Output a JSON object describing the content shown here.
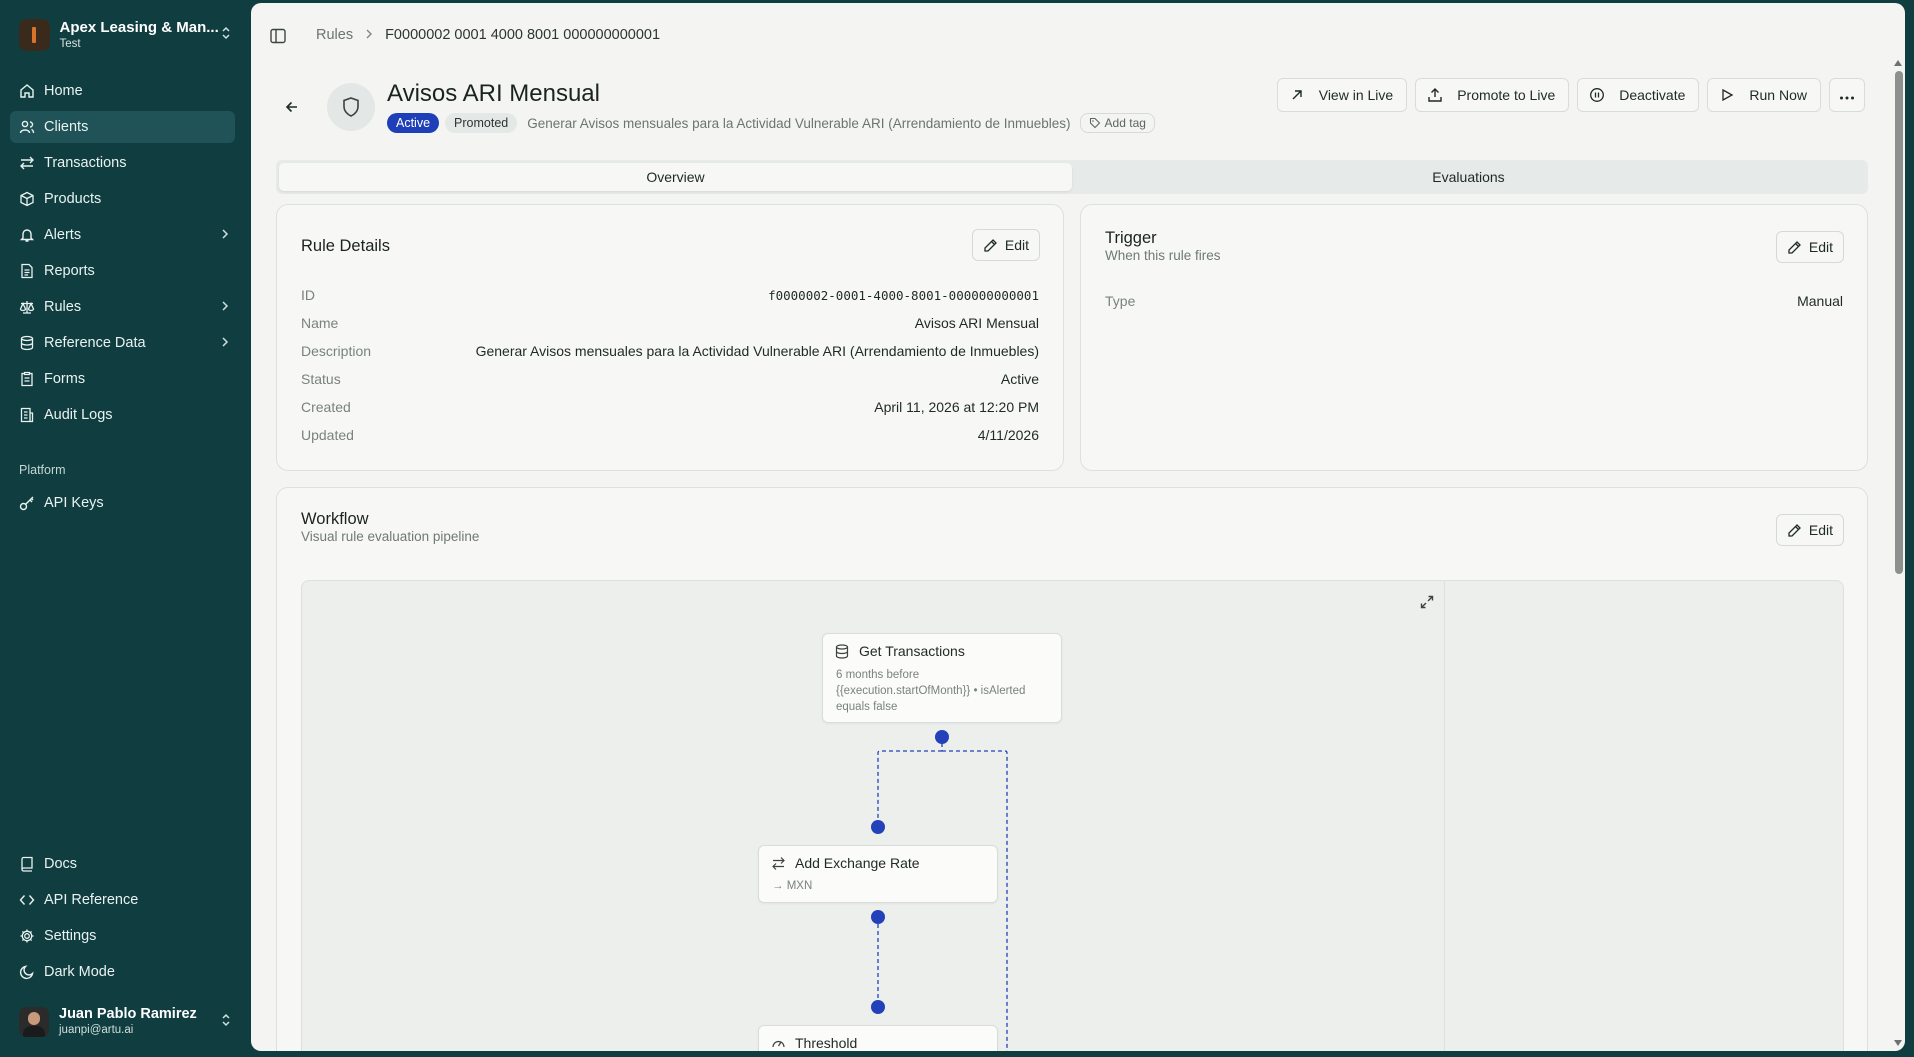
{
  "sidebar": {
    "org_name": "Apex Leasing & Man...",
    "org_env": "Test",
    "nav": [
      {
        "label": "Home",
        "icon": "home-icon"
      },
      {
        "label": "Clients",
        "icon": "users-icon"
      },
      {
        "label": "Transactions",
        "icon": "arrows-left-right-icon"
      },
      {
        "label": "Products",
        "icon": "package-icon"
      },
      {
        "label": "Alerts",
        "icon": "bell-icon"
      },
      {
        "label": "Reports",
        "icon": "file-text-icon"
      },
      {
        "label": "Rules",
        "icon": "scale-icon"
      },
      {
        "label": "Reference Data",
        "icon": "database-icon"
      },
      {
        "label": "Forms",
        "icon": "clipboard-icon"
      },
      {
        "label": "Audit Logs",
        "icon": "logs-icon"
      }
    ],
    "platform_label": "Platform",
    "platform_nav": [
      {
        "label": "API Keys",
        "icon": "key-icon"
      }
    ],
    "bottom_nav": [
      {
        "label": "Docs",
        "icon": "book-icon"
      },
      {
        "label": "API Reference",
        "icon": "code-icon"
      },
      {
        "label": "Settings",
        "icon": "gear-icon"
      },
      {
        "label": "Dark Mode",
        "icon": "moon-icon"
      }
    ],
    "user": {
      "name": "Juan Pablo Ramirez",
      "email": "juanpi@artu.ai"
    }
  },
  "breadcrumb": {
    "parent": "Rules",
    "current": "F0000002 0001 4000 8001 000000000001"
  },
  "rule": {
    "title": "Avisos ARI Mensual",
    "status_badge": "Active",
    "promoted_badge": "Promoted",
    "description": "Generar Avisos mensuales para la Actividad Vulnerable ARI (Arrendamiento de Inmuebles)",
    "add_tag": "Add tag"
  },
  "actions": {
    "view_live": "View in Live",
    "promote": "Promote to Live",
    "deactivate": "Deactivate",
    "run_now": "Run Now"
  },
  "tabs": [
    "Overview",
    "Evaluations"
  ],
  "rule_details": {
    "title": "Rule Details",
    "edit": "Edit",
    "rows": [
      {
        "key": "ID",
        "value": "f0000002-0001-4000-8001-000000000001"
      },
      {
        "key": "Name",
        "value": "Avisos ARI Mensual"
      },
      {
        "key": "Description",
        "value": "Generar Avisos mensuales para la Actividad Vulnerable ARI (Arrendamiento de Inmuebles)"
      },
      {
        "key": "Status",
        "value": "Active"
      },
      {
        "key": "Created",
        "value": "April 11, 2026 at 12:20 PM"
      },
      {
        "key": "Updated",
        "value": "4/11/2026"
      }
    ]
  },
  "trigger": {
    "title": "Trigger",
    "subtitle": "When this rule fires",
    "edit": "Edit",
    "type_key": "Type",
    "type_value": "Manual"
  },
  "workflow": {
    "title": "Workflow",
    "subtitle": "Visual rule evaluation pipeline",
    "edit": "Edit",
    "nodes": [
      {
        "title": "Get Transactions",
        "desc": "6 months before {{execution.startOfMonth}} • isAlerted equals false",
        "icon": "database-icon"
      },
      {
        "title": "Add Exchange Rate",
        "desc": "→ MXN",
        "icon": "arrows-left-right-icon"
      },
      {
        "title": "Threshold",
        "desc": "",
        "icon": "gauge-icon"
      }
    ]
  },
  "colors": {
    "sidebar": "#0f3d40",
    "accent": "#2341b8",
    "background": "#f4f5f3"
  }
}
